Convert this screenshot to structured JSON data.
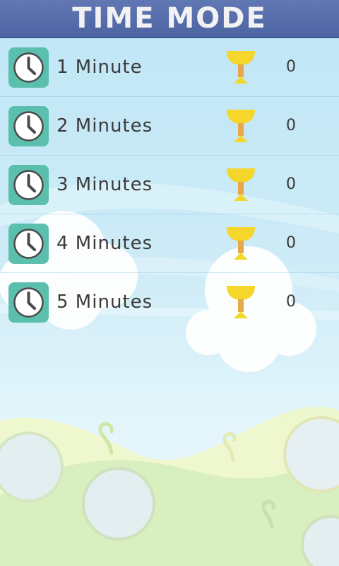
{
  "header": {
    "title": "TIME MODE"
  },
  "modes": [
    {
      "label": "1 Minute",
      "best_score": "0",
      "icon": "clock-icon",
      "trophy": "trophy-icon"
    },
    {
      "label": "2 Minutes",
      "best_score": "0",
      "icon": "clock-icon",
      "trophy": "trophy-icon"
    },
    {
      "label": "3 Minutes",
      "best_score": "0",
      "icon": "clock-icon",
      "trophy": "trophy-icon"
    },
    {
      "label": "4 Minutes",
      "best_score": "0",
      "icon": "clock-icon",
      "trophy": "trophy-icon"
    },
    {
      "label": "5 Minutes",
      "best_score": "0",
      "icon": "clock-icon",
      "trophy": "trophy-icon"
    }
  ],
  "colors": {
    "header_bg": "#5068a8",
    "clock_tile": "#5bbfae",
    "trophy": "#f5d62a",
    "text": "#3b3b3b",
    "sky": "#c6e8f6"
  }
}
